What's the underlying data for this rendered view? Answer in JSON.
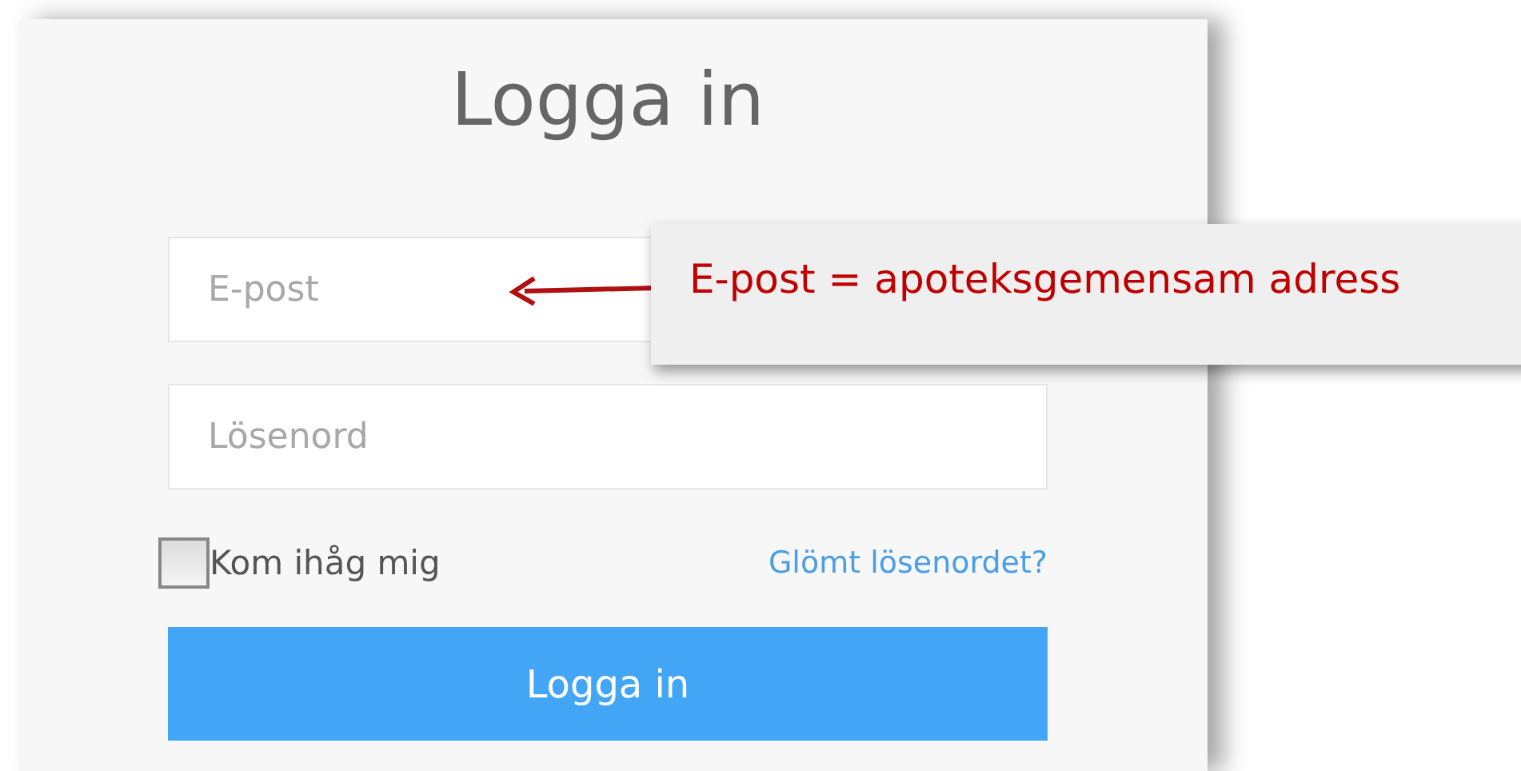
{
  "title": "Logga in",
  "fields": [
    {
      "placeholder": "E-post"
    },
    {
      "placeholder": "Lösenord"
    }
  ],
  "remember": {
    "label": "Kom ihåg mig",
    "checked": false
  },
  "forgot_link": "Glömt lösenordet?",
  "login_button": "Logga in",
  "callout": {
    "text": "E-post = apoteksgemensam adress"
  }
}
